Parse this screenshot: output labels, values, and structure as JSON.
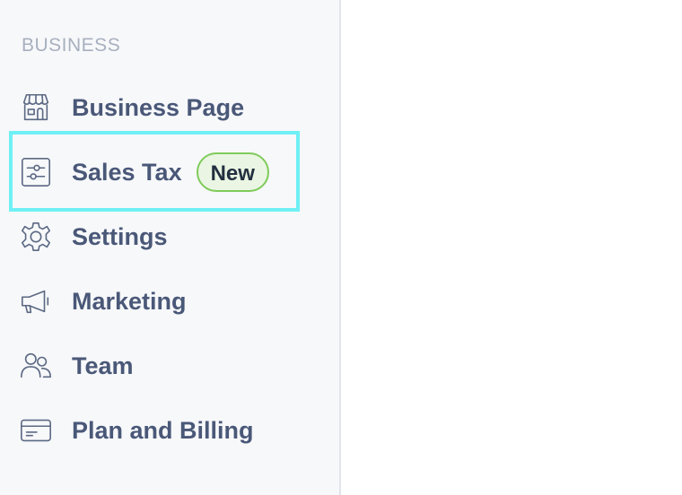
{
  "sidebar": {
    "section_title": "BUSINESS",
    "items": [
      {
        "label": "Business Page",
        "icon": "storefront-icon"
      },
      {
        "label": "Sales Tax",
        "icon": "sliders-icon",
        "badge": "New"
      },
      {
        "label": "Settings",
        "icon": "gear-icon"
      },
      {
        "label": "Marketing",
        "icon": "megaphone-icon"
      },
      {
        "label": "Team",
        "icon": "people-icon"
      },
      {
        "label": "Plan and Billing",
        "icon": "credit-card-icon"
      }
    ]
  },
  "colors": {
    "text": "#4a5878",
    "section_title": "#a8b0bf",
    "badge_border": "#7fcb5a",
    "badge_bg": "#eaf6e3",
    "highlight": "#6ef0f5"
  }
}
